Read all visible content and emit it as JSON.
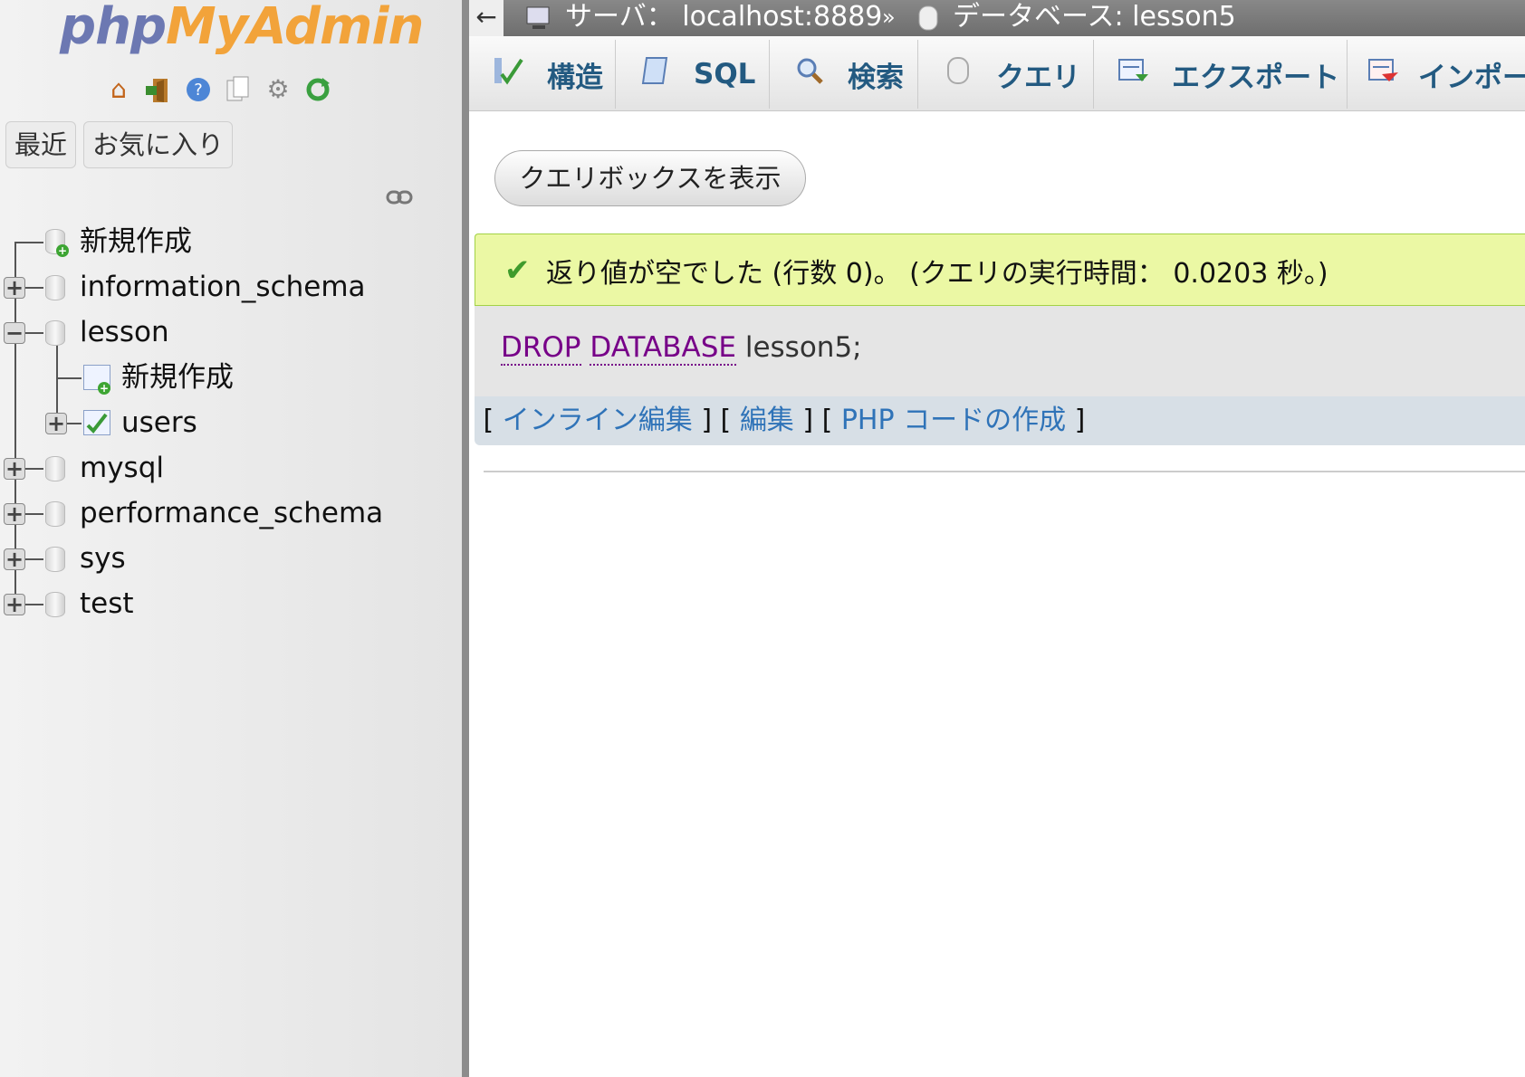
{
  "app": {
    "logo_php": "php",
    "logo_myadmin": "MyAdmin",
    "colors": {
      "logo_php": "#6c78b2",
      "logo_myadmin": "#f2a33a",
      "success_bg": "#ebf8a4",
      "link": "#2f73b8",
      "keyword": "#770088"
    }
  },
  "sidebar": {
    "icons": [
      "home-icon",
      "logout-icon",
      "help-icon",
      "docs-icon",
      "settings-icon",
      "reload-icon"
    ],
    "tabs": {
      "recent": "最近",
      "favorites": "お気に入り"
    },
    "tree": {
      "new_db": "新規作成",
      "databases": [
        {
          "name": "information_schema"
        },
        {
          "name": "lesson",
          "children": {
            "new_table": "新規作成",
            "tables": [
              "users"
            ]
          }
        },
        {
          "name": "mysql"
        },
        {
          "name": "performance_schema"
        },
        {
          "name": "sys"
        },
        {
          "name": "test"
        }
      ]
    }
  },
  "breadcrumb": {
    "back": "←",
    "server_label": "サーバ：",
    "server_value": "localhost:8889",
    "separator": "»",
    "database_label": "データベース:",
    "database_value": "lesson5"
  },
  "tabs": [
    {
      "label": "構造",
      "icon": "structure-icon"
    },
    {
      "label": "SQL",
      "icon": "sql-icon"
    },
    {
      "label": "検索",
      "icon": "search-icon"
    },
    {
      "label": "クエリ",
      "icon": "query-icon"
    },
    {
      "label": "エクスポート",
      "icon": "export-icon"
    },
    {
      "label": "インポー",
      "icon": "import-icon"
    }
  ],
  "main": {
    "query_box_button": "クエリボックスを表示",
    "success_message": "返り値が空でした (行数 0)。 (クエリの実行時間： 0.0203 秒。)",
    "sql": {
      "kw1": "DROP",
      "kw2": "DATABASE",
      "rest": "lesson5;"
    },
    "links": {
      "inline_edit": "インライン編集",
      "edit": "編集",
      "php_code": "PHP コードの作成"
    }
  }
}
